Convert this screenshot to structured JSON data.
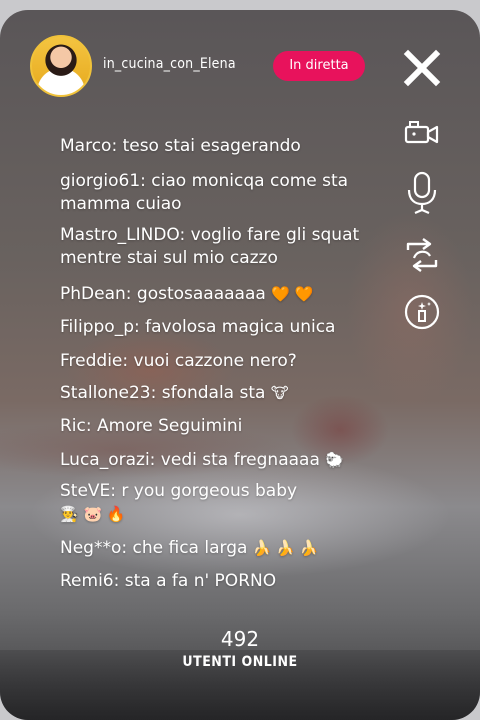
{
  "header": {
    "username": "in_cucina_con_Elena",
    "live_label": "In diretta",
    "avatar_icon": "user-avatar"
  },
  "toolbar": {
    "close_icon": "close-icon",
    "camera_icon": "video-camera-icon",
    "mic_icon": "microphone-icon",
    "switch_icon": "switch-camera-icon",
    "effects_icon": "magic-wand-icon"
  },
  "chat": [
    {
      "text": "Marco: teso stai esagerando",
      "emoji": ""
    },
    {
      "text": "giorgio61: ciao monicqa come sta mamma cuiao",
      "emoji": ""
    },
    {
      "text": "Mastro_LINDO: voglio fare gli squat mentre stai sul mio cazzo",
      "emoji": ""
    },
    {
      "text": "PhDean: gostosaaaaaaa",
      "emoji": "🧡 🧡"
    },
    {
      "text": "Filippo_p: favolosa magica unica",
      "emoji": ""
    },
    {
      "text": "Freddie: vuoi cazzone nero?",
      "emoji": ""
    },
    {
      "text": "Stallone23: sfondala sta",
      "emoji": "🐮"
    },
    {
      "text": "Ric: Amore Seguimini",
      "emoji": ""
    },
    {
      "text": "Luca_orazi: vedi sta fregnaaaa",
      "emoji": "🐑"
    },
    {
      "text": "SteVE: r you gorgeous baby",
      "emoji": "👨‍🍳 🐷 🔥"
    },
    {
      "text": "Neg**o: che fica larga",
      "emoji": "🍌 🍌 🍌"
    },
    {
      "text": "Remi6: sta a fa n' PORNO",
      "emoji": ""
    }
  ],
  "viewers": {
    "count": "492",
    "label": "UTENTI ONLINE"
  },
  "colors": {
    "live_badge": "#e8125c",
    "avatar_ring": "#f0c23a"
  }
}
